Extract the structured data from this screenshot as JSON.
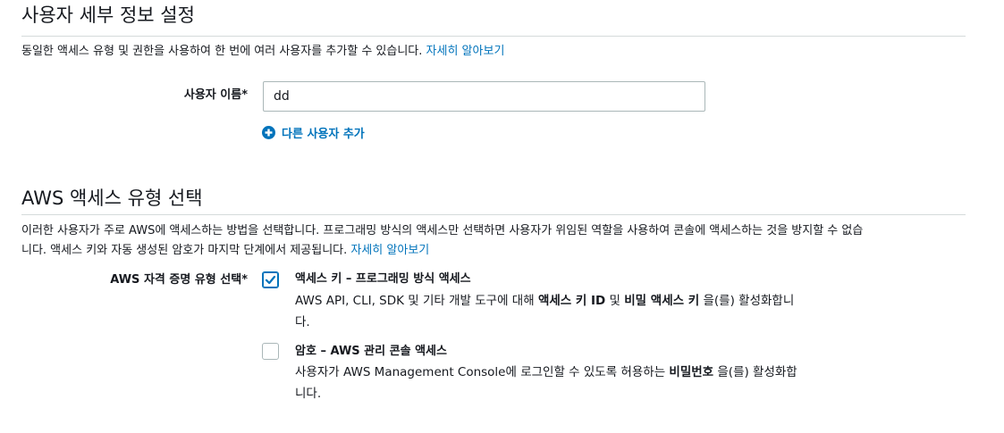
{
  "user_details": {
    "title": "사용자 세부 정보 설정",
    "description": "동일한 액세스 유형 및 권한을 사용하여 한 번에 여러 사용자를 추가할 수 있습니다.",
    "learn_more": "자세히 알아보기",
    "username_label": "사용자 이름*",
    "username_value": "dd",
    "add_user_label": "다른 사용자 추가"
  },
  "access_type": {
    "title": "AWS 액세스 유형 선택",
    "description_line1": "이러한 사용자가 주로 AWS에 액세스하는 방법을 선택합니다. 프로그래밍 방식의 액세스만 선택하면 사용자가 위임된 역할을 사용하여 콘솔에 액세스하는 것을 방지할 수 없습",
    "description_line2": "니다. 액세스 키와 자동 생성된 암호가 마지막 단계에서 제공됩니다.",
    "learn_more": "자세히 알아보기",
    "credential_label": "AWS 자격 증명 유형 선택*",
    "options": [
      {
        "title": "액세스 키 – 프로그래밍 방식 액세스",
        "checked": true,
        "desc_pre": "AWS API, CLI, SDK 및 기타 개발 도구에 대해 ",
        "desc_bold1": "액세스 키 ID",
        "desc_mid": " 및 ",
        "desc_bold2": "비밀 액세스 키",
        "desc_post": " 을(를) 활성화합니",
        "desc_line2": "다."
      },
      {
        "title": "암호 – AWS 관리 콘솔 액세스",
        "checked": false,
        "desc_pre": "사용자가 AWS Management Console에 로그인할 수 있도록 허용하는 ",
        "desc_bold1": "비밀번호",
        "desc_post": " 을(를) 활성화합",
        "desc_line2": "니다."
      }
    ]
  },
  "colors": {
    "link": "#0073bb",
    "text": "#16191f",
    "divider": "#d5dbdb",
    "input_border": "#aab7b8"
  },
  "icons": {
    "add": "plus-circle-icon",
    "check": "checkmark-icon"
  }
}
